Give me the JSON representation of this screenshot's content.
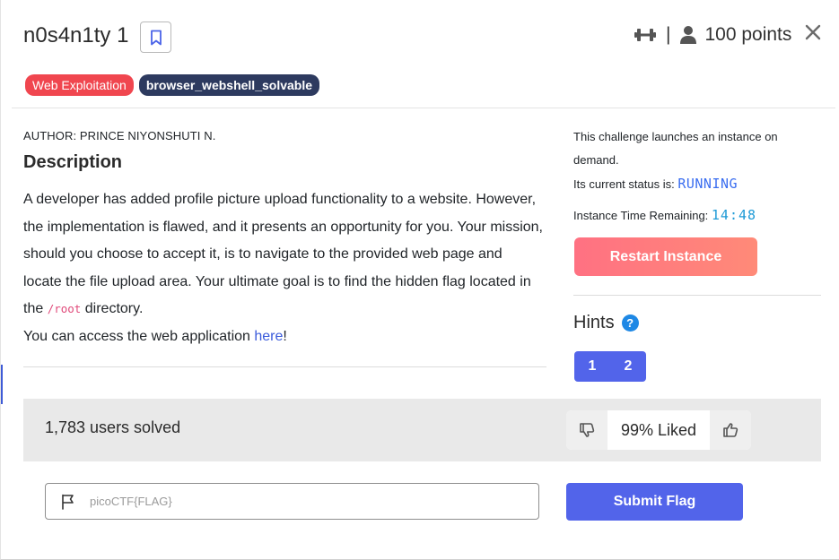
{
  "challenge": {
    "title": "n0s4n1ty 1",
    "points": "100 points",
    "tags": [
      "Web Exploitation",
      "browser_webshell_solvable"
    ],
    "author": "AUTHOR: PRINCE NIYONSHUTI N."
  },
  "description": {
    "heading": "Description",
    "line1": "A developer has added profile picture upload functionality to a website. However, the implementation is flawed, and it presents an opportunity for you. Your mission, should you choose to accept it, is to navigate to the provided web page and locate the file upload area. Your ultimate goal is to find the hidden flag located in the ",
    "code": "/root",
    "line1_end": " directory.",
    "access_prefix": "You can access the web application ",
    "access_link": "here",
    "access_suffix": "!"
  },
  "instance": {
    "launch_text": "This challenge launches an instance on demand.",
    "status_label": "Its current status is: ",
    "status_value": "RUNNING",
    "time_label": "Instance Time Remaining: ",
    "time_value": "14:48",
    "restart_label": "Restart Instance"
  },
  "hints": {
    "heading": "Hints",
    "help_glyph": "?",
    "items": [
      "1",
      "2"
    ]
  },
  "stats": {
    "solved": "1,783 users solved",
    "liked": "99% Liked"
  },
  "flag_form": {
    "placeholder": "picoCTF{FLAG}",
    "submit_label": "Submit Flag"
  },
  "icons": {
    "bookmark": "bookmark-icon",
    "difficulty": "dumbbell-icon",
    "user": "user-icon",
    "close": "close-icon",
    "thumbs_down": "thumbs-down-icon",
    "thumbs_up": "thumbs-up-icon",
    "flag": "flag-icon"
  },
  "colors": {
    "accent": "#5264ea",
    "restart_gradient_start": "#ff7182",
    "tag_red": "#f0464f",
    "tag_dark": "#2d3a5f",
    "status_blue": "#3b6ef0",
    "timer_cyan": "#1e9ad6"
  }
}
